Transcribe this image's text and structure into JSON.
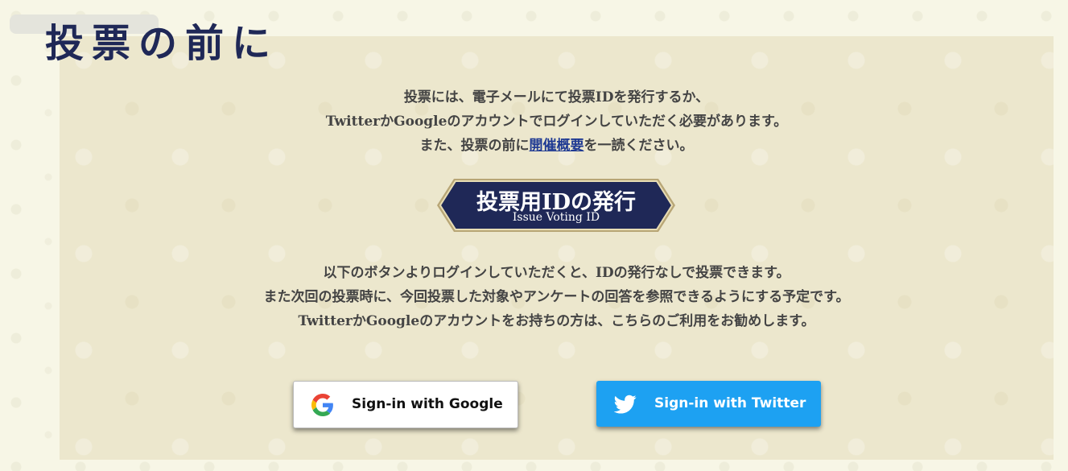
{
  "page": {
    "title": "投票の前に"
  },
  "intro": {
    "line1": "投票には、電子メールにて投票IDを発行するか、",
    "line2": "TwitterかGoogleのアカウントでログインしていただく必要があります。",
    "line3_before": "また、投票の前に",
    "line3_link": "開催概要",
    "line3_after": "を一読ください。"
  },
  "issue_button": {
    "title": "投票用IDの発行",
    "subtitle": "Issue Voting ID",
    "fill_color": "#1f2857",
    "border_color": "#c8b98a"
  },
  "login_info": {
    "line1": "以下のボタンよりログインしていただくと、IDの発行なしで投票できます。",
    "line2": "また次回の投票時に、今回投票した対象やアンケートの回答を参照できるようにする予定です。",
    "line3": "TwitterかGoogleのアカウントをお持ちの方は、こちらのご利用をお勧めします。"
  },
  "buttons": {
    "google": {
      "label": "Sign-in with Google",
      "icon": "google-icon"
    },
    "twitter": {
      "label": "Sign-in with Twitter",
      "icon": "twitter-icon",
      "color": "#1da1f2"
    }
  }
}
